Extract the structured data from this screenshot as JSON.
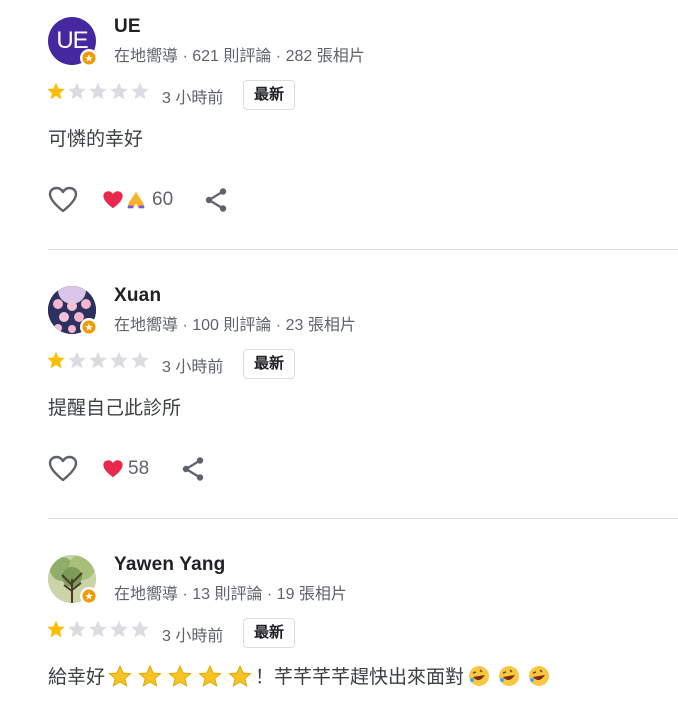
{
  "reviews": [
    {
      "name": "UE",
      "avatar_text": "UE",
      "avatar_color": "#4527a0",
      "meta": "在地嚮導 · 621 則評論 · 282 張相片",
      "rating": 1,
      "time": "3 小時前",
      "new_label": "最新",
      "text": "可憐的幸好",
      "reactions": [
        "heart",
        "pray"
      ],
      "reaction_count": "60"
    },
    {
      "name": "Xuan",
      "meta": "在地嚮導 · 100 則評論 · 23 張相片",
      "rating": 1,
      "time": "3 小時前",
      "new_label": "最新",
      "text": "提醒自己此診所",
      "reactions": [
        "heart"
      ],
      "reaction_count": "58"
    },
    {
      "name": "Yawen Yang",
      "meta": "在地嚮導 · 13 則評論 · 19 張相片",
      "rating": 1,
      "time": "3 小時前",
      "new_label": "最新",
      "text_parts": [
        "給幸好",
        "！芊芊芊芊趕快出來面對"
      ]
    }
  ],
  "colors": {
    "star_filled": "#fbbc04",
    "star_empty": "#dadce0",
    "heart": "#e8284d",
    "text_secondary": "#5f6368"
  },
  "icons": {
    "like": "heart-outline-icon",
    "share": "share-icon",
    "badge": "local-guide-star-icon"
  }
}
